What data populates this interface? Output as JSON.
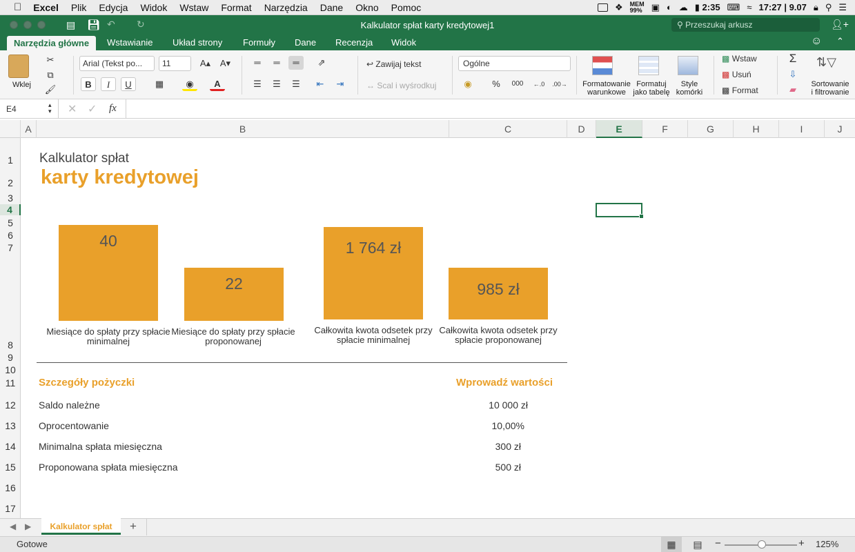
{
  "menubar": {
    "app": "Excel",
    "items": [
      "Plik",
      "Edycja",
      "Widok",
      "Wstaw",
      "Format",
      "Narzędzia",
      "Dane",
      "Okno",
      "Pomoc"
    ],
    "battery_time": "2:35",
    "clock": "17:27 | 9.07",
    "mem_label": "MEM",
    "mem_value": "99%"
  },
  "window": {
    "title": "Kalkulator spłat karty kredytowej1",
    "search_placeholder": "Przeszukaj arkusz"
  },
  "ribbon_tabs": [
    "Narzędzia główne",
    "Wstawianie",
    "Układ strony",
    "Formuły",
    "Dane",
    "Recenzja",
    "Widok"
  ],
  "ribbon": {
    "paste": "Wklej",
    "font_name": "Arial (Tekst po...",
    "font_size": "11",
    "wrap_text": "Zawijaj tekst",
    "merge_center": "Scal i wyśrodkuj",
    "number_format": "Ogólne",
    "percent": "%",
    "thousands": "000",
    "cond_format": [
      "Formatowanie",
      "warunkowe"
    ],
    "format_table": [
      "Formatuj",
      "jako tabelę"
    ],
    "cell_styles": [
      "Style",
      "komórki"
    ],
    "insert": "Wstaw",
    "delete": "Usuń",
    "format": "Format",
    "sort_filter": [
      "Sortowanie",
      "i filtrowanie"
    ],
    "bold": "B",
    "italic": "I",
    "underline": "U"
  },
  "formula_bar": {
    "cell_ref": "E4",
    "fx": "fx",
    "value": ""
  },
  "columns": [
    "A",
    "B",
    "C",
    "D",
    "E",
    "F",
    "G",
    "H",
    "I",
    "J"
  ],
  "rows": [
    "1",
    "2",
    "3",
    "4",
    "5",
    "6",
    "7",
    "8",
    "9",
    "10",
    "11",
    "12",
    "13",
    "14",
    "15",
    "16",
    "17"
  ],
  "sheet": {
    "title_line1": "Kalkulator spłat",
    "title_line2": "karty kredytowej",
    "summary": [
      {
        "value": "40",
        "label_line1": "Miesiące do spłaty przy spłacie",
        "label_line2": "minimalnej"
      },
      {
        "value": "22",
        "label_line1": "Miesiące do spłaty przy spłacie",
        "label_line2": "proponowanej"
      },
      {
        "value": "1 764 zł",
        "label_line1": "Całkowita kwota odsetek przy",
        "label_line2": "spłacie minimalnej"
      },
      {
        "value": "985 zł",
        "label_line1": "Całkowita kwota odsetek przy",
        "label_line2": "spłacie proponowanej"
      }
    ],
    "details_header": "Szczegóły pożyczki",
    "values_header": "Wprowadź wartości",
    "details": [
      {
        "label": "Saldo należne",
        "value": "10 000 zł"
      },
      {
        "label": "Oprocentowanie",
        "value": "10,00%"
      },
      {
        "label": "Minimalna spłata miesięczna",
        "value": "300 zł"
      },
      {
        "label": "Proponowana spłata miesięczna",
        "value": "500 zł"
      }
    ]
  },
  "sheet_tabs": {
    "active": "Kalkulator spłat",
    "add": "+"
  },
  "status": {
    "ready": "Gotowe",
    "zoom": "125%",
    "zoom_level_percent": 125
  },
  "colors": {
    "accent": "#227447",
    "orange": "#e9a02a"
  }
}
